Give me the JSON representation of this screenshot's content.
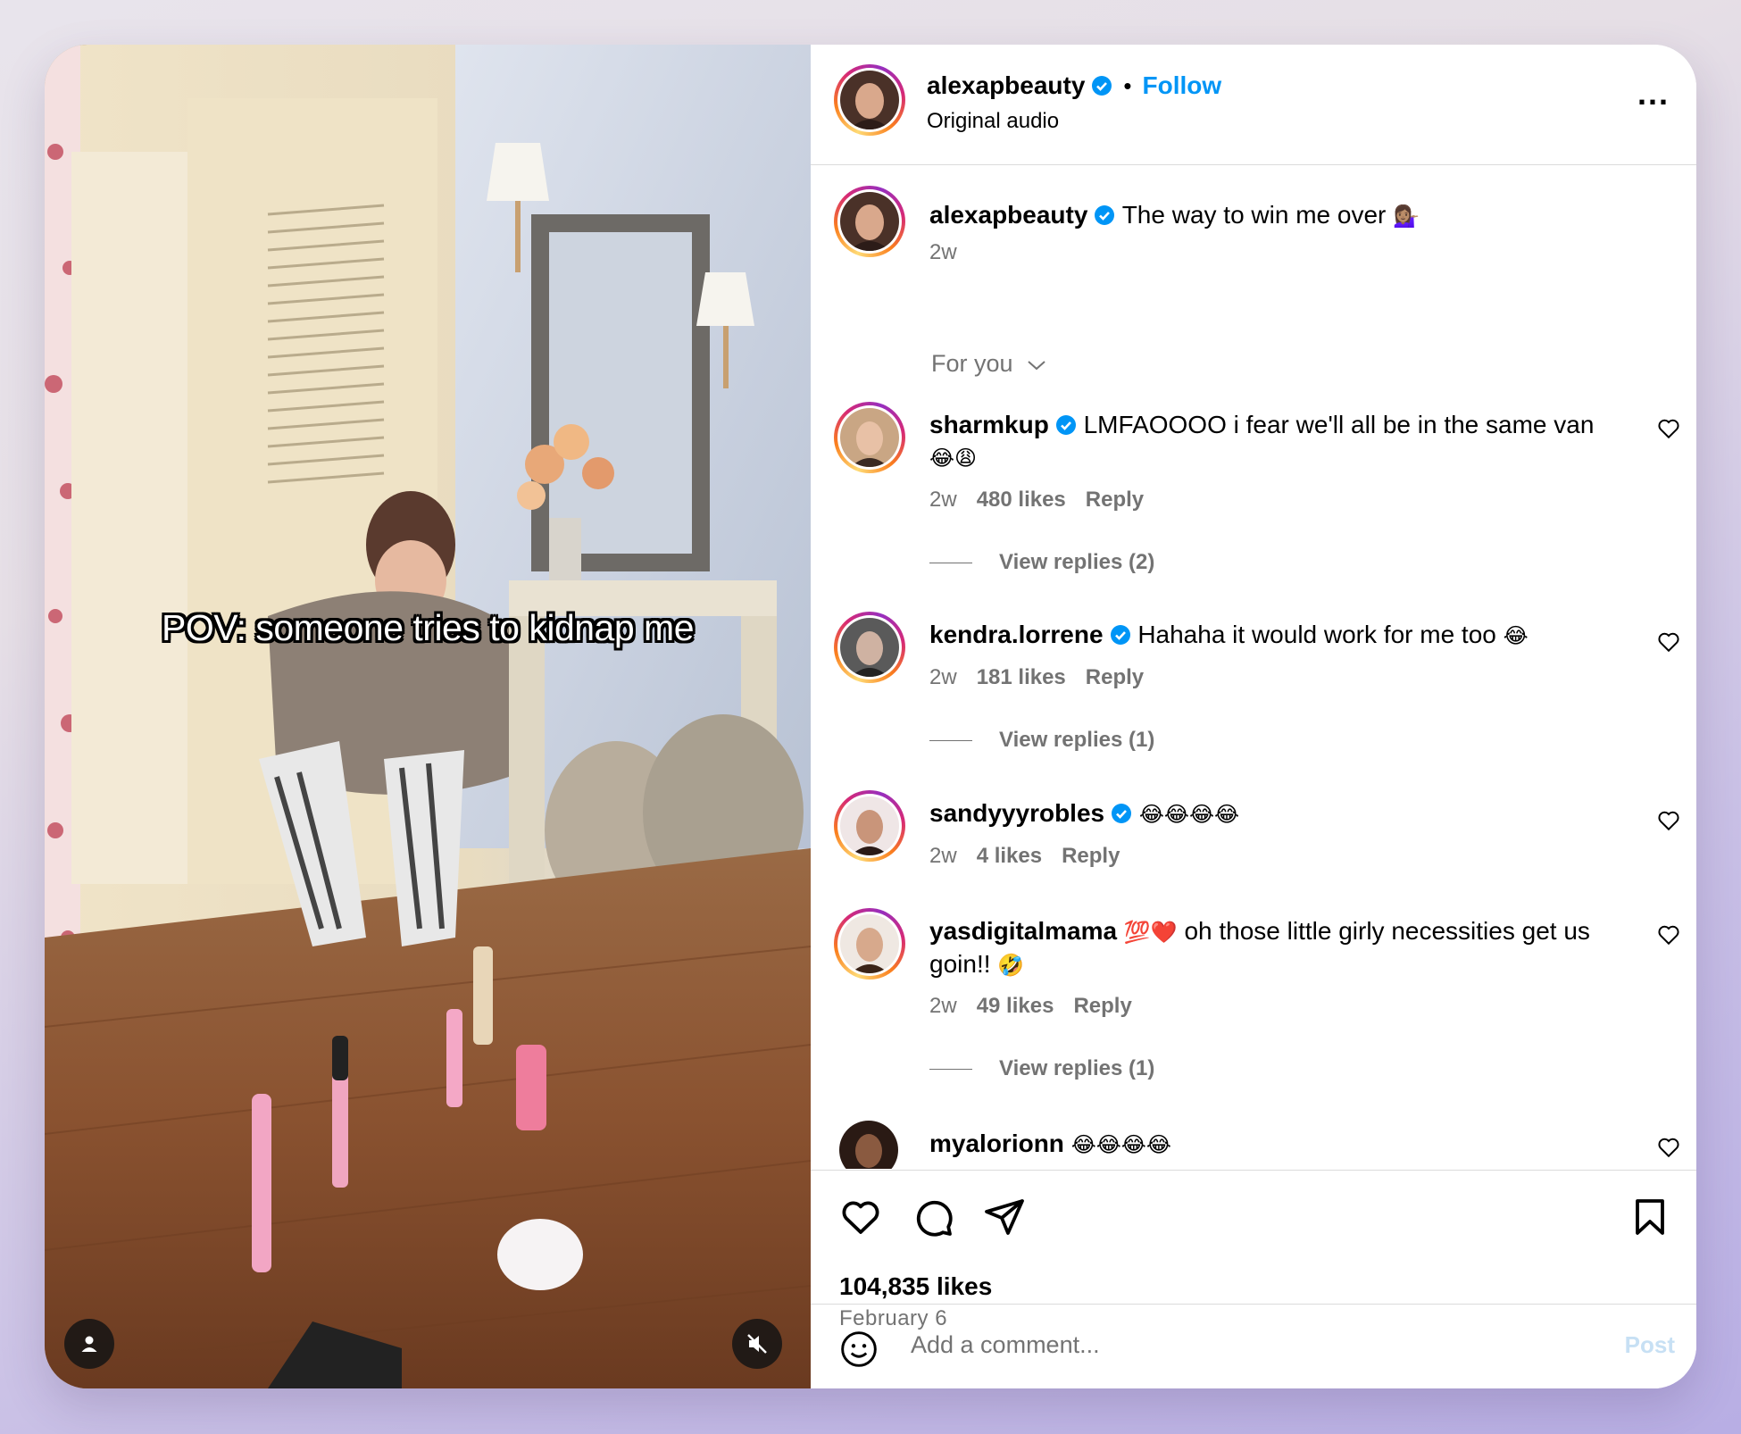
{
  "video": {
    "overlay_text": "POV: someone tries to kidnap me",
    "user_icon": "person-icon",
    "mute_icon": "speaker-muted-icon"
  },
  "header": {
    "username": "alexapbeauty",
    "separator": "•",
    "follow_label": "Follow",
    "audio": "Original audio",
    "more_label": "..."
  },
  "caption": {
    "username": "alexapbeauty",
    "text": "The way to win me over",
    "emoji": "💁🏽‍♀️",
    "time": "2w"
  },
  "filter": {
    "label": "For you"
  },
  "comments": [
    {
      "username": "sharmkup",
      "verified": true,
      "text": "LMFAOOOO i fear we'll all be in the same van",
      "emoji": "😂😩",
      "time": "2w",
      "likes": "480 likes",
      "reply": "Reply",
      "view_replies": "View replies (2)"
    },
    {
      "username": "kendra.lorrene",
      "verified": true,
      "text": "Hahaha it would work for me too",
      "emoji": "😂",
      "time": "2w",
      "likes": "181 likes",
      "reply": "Reply",
      "view_replies": "View replies (1)"
    },
    {
      "username": "sandyyyrobles",
      "verified": true,
      "text": "",
      "emoji": "😂😂😂😂",
      "time": "2w",
      "likes": "4 likes",
      "reply": "Reply"
    },
    {
      "username": "yasdigitalmama",
      "verified": false,
      "name_emoji": "💯❤️",
      "text": "oh those little girly necessities get us goin!!",
      "emoji": "🤣",
      "time": "2w",
      "likes": "49 likes",
      "reply": "Reply",
      "view_replies": "View replies (1)"
    },
    {
      "username": "myalorionn",
      "verified": false,
      "text": "",
      "emoji": "😂😂😂😂"
    }
  ],
  "actions": {
    "like_icon": "heart-icon",
    "comment_icon": "comment-bubble-icon",
    "share_icon": "paper-plane-icon",
    "save_icon": "bookmark-icon",
    "likes_total": "104,835 likes",
    "date": "February 6"
  },
  "add_comment": {
    "placeholder": "Add a comment...",
    "post_label": "Post",
    "emoji_icon": "smiley-icon"
  },
  "colors": {
    "follow_blue": "#0095f6",
    "verified_blue": "#0095f6",
    "meta_gray": "#737373",
    "divider": "#dbdbdb",
    "post_disabled": "#c7e0f4"
  }
}
